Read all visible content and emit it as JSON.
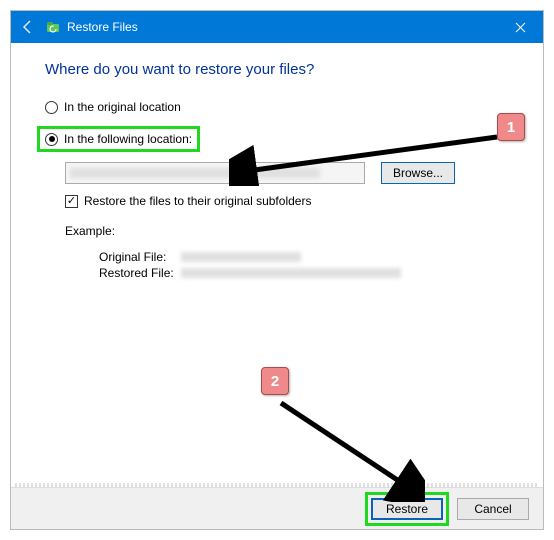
{
  "titlebar": {
    "title": "Restore Files"
  },
  "heading": "Where do you want to restore your files?",
  "radios": {
    "original": {
      "label": "In the original location",
      "checked": false
    },
    "following": {
      "label": "In the following location:",
      "checked": true
    }
  },
  "path_row": {
    "browse_label": "Browse..."
  },
  "checkbox": {
    "label": "Restore the files to their original subfolders",
    "checked": true
  },
  "example": {
    "title": "Example:",
    "original_label": "Original File:",
    "restored_label": "Restored File:"
  },
  "footer": {
    "restore_label": "Restore",
    "cancel_label": "Cancel"
  },
  "annotations": {
    "badge1": "1",
    "badge2": "2"
  }
}
